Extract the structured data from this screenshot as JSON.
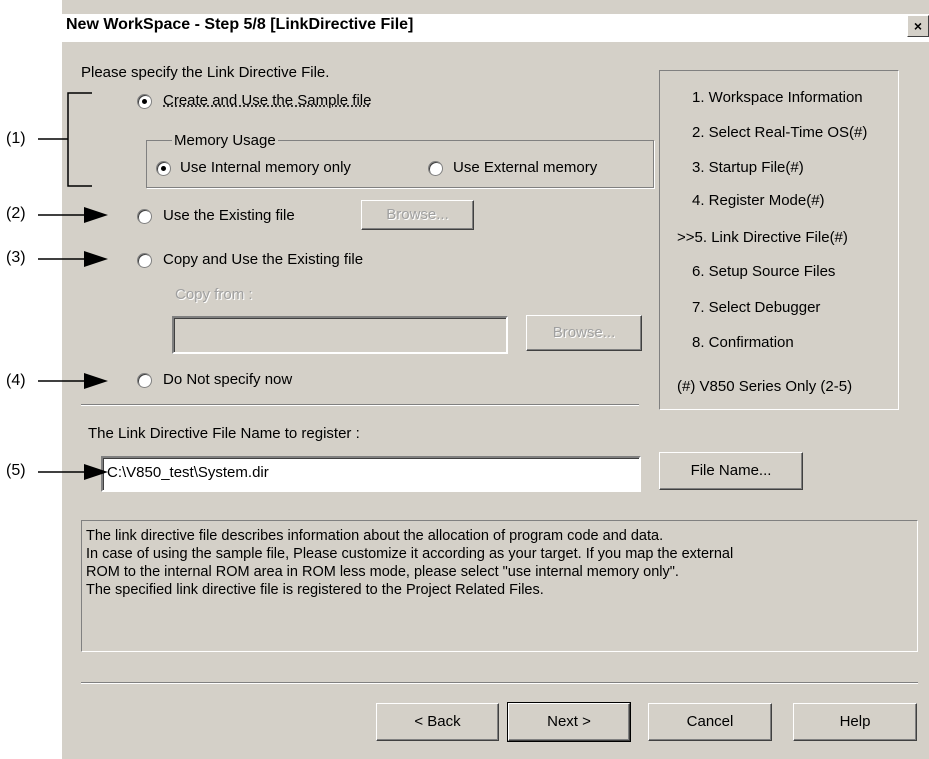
{
  "window": {
    "title": "New WorkSpace - Step 5/8 [LinkDirective File]",
    "close_label": "×"
  },
  "intro": "Please specify the Link Directive File.",
  "options": {
    "create_sample": "Create and Use the Sample file",
    "memory_group": "Memory Usage",
    "internal_only": "Use Internal memory only",
    "external": "Use External memory",
    "use_existing": "Use the Existing file",
    "copy_existing": "Copy and Use the Existing file",
    "copy_from": "Copy from :",
    "do_not_specify": "Do Not specify now",
    "browse": "Browse...",
    "browse2": "Browse..."
  },
  "register_label": "The Link Directive File Name to register :",
  "file_name_value": "C:\\V850_test\\System.dir",
  "copy_from_value": "",
  "file_name_button": "File Name...",
  "steps": [
    "1. Workspace Information",
    "2. Select Real-Time OS(#)",
    "3. Startup File(#)",
    "4. Register Mode(#)",
    ">>5. Link Directive File(#)",
    "6. Setup Source Files",
    "7. Select Debugger",
    "8. Confirmation"
  ],
  "steps_note": "(#) V850 Series Only (2-5)",
  "description": [
    "The link directive file describes information about the allocation of program code and data.",
    "In case of using the sample file, Please customize it according as your target. If you map the external",
    "ROM to the internal ROM area in ROM less mode, please select \"use internal memory only\".",
    "The specified link directive file is registered to the Project Related Files."
  ],
  "buttons": {
    "back": "< Back",
    "next": "Next >",
    "cancel": "Cancel",
    "help": "Help"
  },
  "annotations": {
    "a1": "(1)",
    "a2": "(2)",
    "a3": "(3)",
    "a4": "(4)",
    "a5": "(5)"
  },
  "state": {
    "create_sample_selected": true,
    "internal_only_selected": true
  }
}
